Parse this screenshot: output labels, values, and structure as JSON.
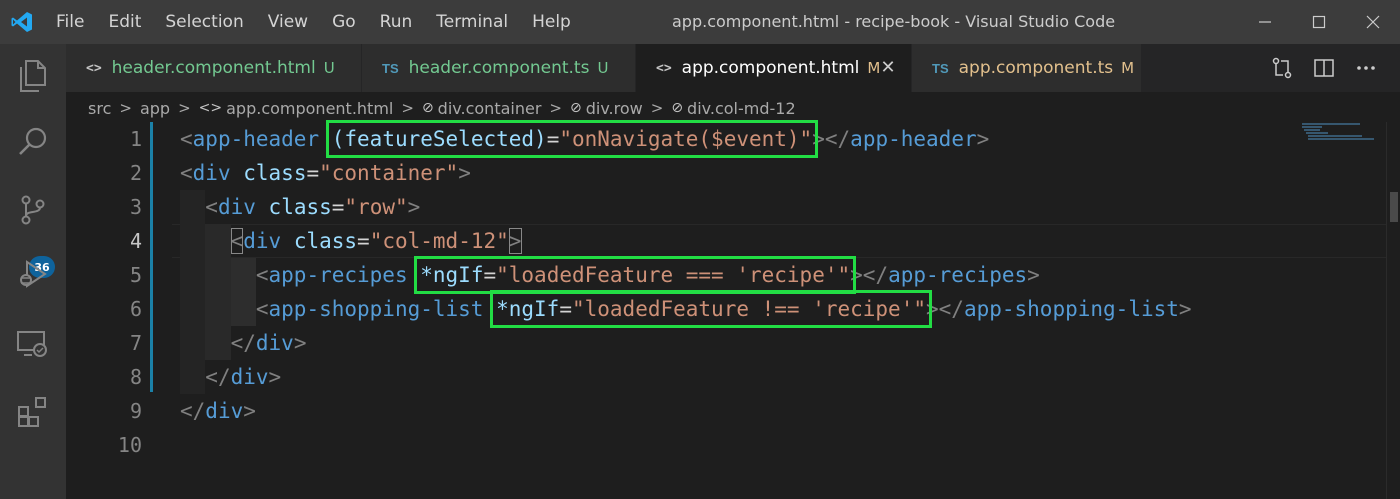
{
  "titlebar": {
    "menu": [
      "File",
      "Edit",
      "Selection",
      "View",
      "Go",
      "Run",
      "Terminal",
      "Help"
    ],
    "window_title": "app.component.html - recipe-book - Visual Studio Code"
  },
  "activity_bar": {
    "icons": [
      "explorer-icon",
      "search-icon",
      "source-control-icon",
      "run-debug-icon",
      "remote-explorer-icon",
      "extensions-icon"
    ],
    "source_control_badge": "36"
  },
  "tabs": [
    {
      "icon": "<>",
      "name": "header.component.html",
      "status": "U",
      "active": false
    },
    {
      "icon": "TS",
      "name": "header.component.ts",
      "status": "U",
      "active": false
    },
    {
      "icon": "<>",
      "name": "app.component.html",
      "status": "M",
      "active": true
    },
    {
      "icon": "TS",
      "name": "app.component.ts",
      "status": "M",
      "active": false
    }
  ],
  "breadcrumb": {
    "src": "src",
    "app": "app",
    "file": "app.component.html",
    "el1": "div.container",
    "el2": "div.row",
    "el3": "div.col-md-12"
  },
  "editor": {
    "current_line": 4,
    "lines": [
      {
        "n": "1",
        "text": "<app-header (featureSelected)=\"onNavigate($event)\"></app-header>"
      },
      {
        "n": "2",
        "text": "<div class=\"container\">"
      },
      {
        "n": "3",
        "text": "  <div class=\"row\">"
      },
      {
        "n": "4",
        "text": "    <div class=\"col-md-12\">"
      },
      {
        "n": "5",
        "text": "      <app-recipes *ngIf=\"loadedFeature === 'recipe'\"></app-recipes>"
      },
      {
        "n": "6",
        "text": "      <app-shopping-list *ngIf=\"loadedFeature !== 'recipe'\"></app-shopping-list>"
      },
      {
        "n": "7",
        "text": "    </div>"
      },
      {
        "n": "8",
        "text": "  </div>"
      },
      {
        "n": "9",
        "text": "</div>"
      },
      {
        "n": "10",
        "text": ""
      }
    ],
    "highlights": [
      "(featureSelected)=\"onNavigate($event)\"",
      "*ngIf=\"loadedFeature === 'recipe'\"",
      "*ngIf=\"loadedFeature !== 'recipe'\""
    ]
  },
  "colors": {
    "highlight_box": "#22dd44",
    "tag": "#569cd6",
    "attribute": "#9cdcfe",
    "string": "#ce9178",
    "bracket": "#808080"
  }
}
